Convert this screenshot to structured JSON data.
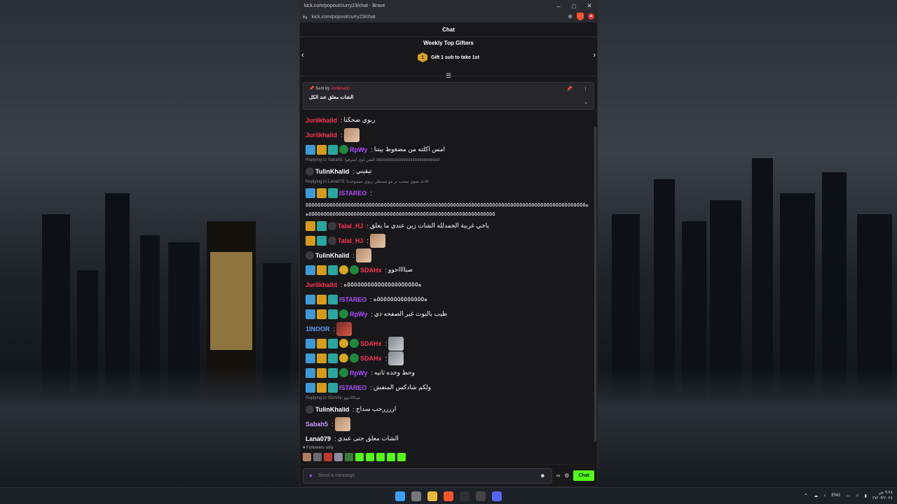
{
  "window": {
    "title": "kick.com/popout/curry23/chat - Brave",
    "url": "kick.com/popout/curry23/chat",
    "controls": {
      "minimize": "–",
      "maximize": "□",
      "close": "✕"
    }
  },
  "chat": {
    "header": "Chat",
    "top_gifters": {
      "title": "Weekly Top Gifters",
      "badge": "1",
      "text": "Gift 1 sub to take 1st"
    },
    "pinned": {
      "sent_by_label": "Sent by",
      "sent_by_user": "Jurilkhalid",
      "text": "الشات معلق عند الكل"
    },
    "messages": [
      {
        "user": "Jurilkhalid",
        "color": "#ff3355",
        "text": "ربوي ضحكنا"
      },
      {
        "user": "Jurilkhalid",
        "color": "#ff3355",
        "emote": "face"
      },
      {
        "user": "RpWy",
        "color": "#b14bff",
        "badges": [
          "pick",
          "crown",
          "og",
          "vip"
        ],
        "text": "امس اكلته من مضغوط بيتنا"
      },
      {
        "reply": "Replying to Sabah5: ٥٥٥٥٥٥٥٥٥٥٥٥٥٥٥٥٥٥٥٥٥٥٥٥٥٥٥٥ البقي اوي اشرفوا",
        "user": "TulinKhalid",
        "color": "#ffffff",
        "badges": [
          "mic"
        ],
        "text": "تيقيني"
      },
      {
        "reply": "Replying to Lana079: الاحد صوي سحب بر مو مسطي ربوي مستوجدنا",
        "user": "ISTAREO",
        "color": "#b14bff",
        "badges": [
          "pick",
          "crown",
          "og"
        ],
        "text": ""
      },
      {
        "long": "ه٥٥٥٥٥٥٥٥٥٥٥٥٥٥٥٥٥٥٥٥٥٥٥٥٥٥٥٥٥٥٥٥٥٥٥٥٥٥٥٥٥٥٥٥٥٥٥٥٥٥٥٥٥٥٥٥٥٥٥٥٥٥٥٥٥٥٥٥٥٥٥٥٥٥٥٥٥٥٥٥٥٥٥٥٥٥٥٥٥٥٥٥٥٥٥٥٥٥٥٥٥٥٥٥٥٥٥٥٥٥٥٥٥٥٥٥٥٥٥٥٥٥٥٥٥٥٥٥٥٥٥٥٥٥٥٥٥٥٥٥٥٥٥٥٥٥٥٥٥٥٥٥٥٥٥ه"
      },
      {
        "user": "Talal_HJ",
        "color": "#ff3355",
        "badges": [
          "crown",
          "og",
          "mic"
        ],
        "text": "ياخي غربية الحمدلله الشات زين عندي ما يعلق"
      },
      {
        "user": "Talal_HJ",
        "color": "#ff3355",
        "badges": [
          "crown",
          "og",
          "mic"
        ],
        "emote": "face"
      },
      {
        "user": "TulinKhalid",
        "color": "#ffffff",
        "badges": [
          "mic"
        ],
        "emote": "face"
      },
      {
        "user": "SDAHx",
        "color": "#ff3355",
        "badges": [
          "pick",
          "crown",
          "og",
          "coin",
          "vip"
        ],
        "text": "صبااااحوو"
      },
      {
        "user": "Jurilkhalid",
        "color": "#ff3355",
        "text": "ه٥٥٥٥٥٥٥٥٥٥٥٥٥٥٥٥٥٥٥٥٥ه"
      },
      {
        "user": "ISTAREO",
        "color": "#b14bff",
        "badges": [
          "pick",
          "crown",
          "og"
        ],
        "text": "ه٥٥٥٥٥٥٥٥٥٥٥٥٥٥ه"
      },
      {
        "user": "RpWy",
        "color": "#b14bff",
        "badges": [
          "pick",
          "crown",
          "og",
          "vip"
        ],
        "text": "طيب بالبوت غير الصفحه ذي"
      },
      {
        "user": "1INOOR",
        "color": "#5aa0ff",
        "emote": "red"
      },
      {
        "user": "SDAHx",
        "color": "#ff3355",
        "badges": [
          "pick",
          "crown",
          "og",
          "coin",
          "vip"
        ],
        "emote": "gray"
      },
      {
        "user": "SDAHx",
        "color": "#ff3355",
        "badges": [
          "pick",
          "crown",
          "og",
          "coin",
          "vip"
        ],
        "emote": "gray"
      },
      {
        "user": "RpWy",
        "color": "#b14bff",
        "badges": [
          "pick",
          "crown",
          "og",
          "vip"
        ],
        "text": "وحط وحده ثانيه"
      },
      {
        "user": "ISTAREO",
        "color": "#b14bff",
        "badges": [
          "pick",
          "crown",
          "og"
        ],
        "text": "ولكم شادكس المتفش"
      },
      {
        "reply": "Replying to SDAHx: صبااااحوو",
        "user": "TulinKhalid",
        "color": "#ffffff",
        "badges": [
          "mic"
        ],
        "text": "اررررحب سداح"
      },
      {
        "user": "Sabah5",
        "color": "#c79bff",
        "emote": "face"
      },
      {
        "user": "Lana079",
        "color": "#ffffff",
        "text": "الشات معلق حتى عندي"
      }
    ],
    "followers_only": "Followers only",
    "input_placeholder": "Send a message",
    "chat_button": "Chat"
  },
  "taskbar": {
    "lang": "ENG",
    "time": "٩:٢٨ ص",
    "date": "٢٧/٠٣/٢٠٢٤"
  }
}
